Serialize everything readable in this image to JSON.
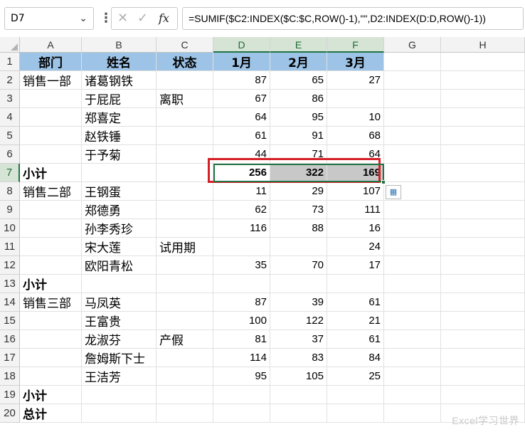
{
  "formula_bar": {
    "name_box": "D7",
    "formula": "=SUMIF($C2:INDEX($C:$C,ROW()-1),\"\",D2:INDEX(D:D,ROW()-1))"
  },
  "columns": [
    "A",
    "B",
    "C",
    "D",
    "E",
    "F",
    "G",
    "H"
  ],
  "rows": [
    "1",
    "2",
    "3",
    "4",
    "5",
    "6",
    "7",
    "8",
    "9",
    "10",
    "11",
    "12",
    "13",
    "14",
    "15",
    "16",
    "17",
    "18",
    "19",
    "20"
  ],
  "table": {
    "headers": [
      "部门",
      "姓名",
      "状态",
      "1月",
      "2月",
      "3月"
    ],
    "rows": [
      {
        "dept": "销售一部",
        "name": "诸葛钢铁",
        "status": "",
        "m1": "87",
        "m2": "65",
        "m3": "27"
      },
      {
        "dept": "",
        "name": "于屁屁",
        "status": "离职",
        "m1": "67",
        "m2": "86",
        "m3": ""
      },
      {
        "dept": "",
        "name": "郑喜定",
        "status": "",
        "m1": "64",
        "m2": "95",
        "m3": "10"
      },
      {
        "dept": "",
        "name": "赵铁锤",
        "status": "",
        "m1": "61",
        "m2": "91",
        "m3": "68"
      },
      {
        "dept": "",
        "name": "于予菊",
        "status": "",
        "m1": "44",
        "m2": "71",
        "m3": "64"
      },
      {
        "dept": "小计",
        "name": "",
        "status": "",
        "m1": "256",
        "m2": "322",
        "m3": "169"
      },
      {
        "dept": "销售二部",
        "name": "王钢蛋",
        "status": "",
        "m1": "11",
        "m2": "29",
        "m3": "107"
      },
      {
        "dept": "",
        "name": "郑德勇",
        "status": "",
        "m1": "62",
        "m2": "73",
        "m3": "111"
      },
      {
        "dept": "",
        "name": "孙李秀珍",
        "status": "",
        "m1": "116",
        "m2": "88",
        "m3": "16"
      },
      {
        "dept": "",
        "name": "宋大莲",
        "status": "试用期",
        "m1": "",
        "m2": "",
        "m3": "24"
      },
      {
        "dept": "",
        "name": "欧阳青松",
        "status": "",
        "m1": "35",
        "m2": "70",
        "m3": "17"
      },
      {
        "dept": "小计",
        "name": "",
        "status": "",
        "m1": "",
        "m2": "",
        "m3": ""
      },
      {
        "dept": "销售三部",
        "name": "马凤英",
        "status": "",
        "m1": "87",
        "m2": "39",
        "m3": "61"
      },
      {
        "dept": "",
        "name": "王富贵",
        "status": "",
        "m1": "100",
        "m2": "122",
        "m3": "21"
      },
      {
        "dept": "",
        "name": "龙淑芬",
        "status": "产假",
        "m1": "81",
        "m2": "37",
        "m3": "61"
      },
      {
        "dept": "",
        "name": "詹姆斯下士",
        "status": "",
        "m1": "114",
        "m2": "83",
        "m3": "84"
      },
      {
        "dept": "",
        "name": "王洁芳",
        "status": "",
        "m1": "95",
        "m2": "105",
        "m3": "25"
      },
      {
        "dept": "小计",
        "name": "",
        "status": "",
        "m1": "",
        "m2": "",
        "m3": ""
      },
      {
        "dept": "总计",
        "name": "",
        "status": "",
        "m1": "",
        "m2": "",
        "m3": ""
      }
    ]
  },
  "watermark": "Excel学习世界",
  "colors": {
    "header_fill": "#9dc3e6",
    "selection": "#217346",
    "highlight_box": "#d62027",
    "selected_fill": "#c8c8c8"
  }
}
